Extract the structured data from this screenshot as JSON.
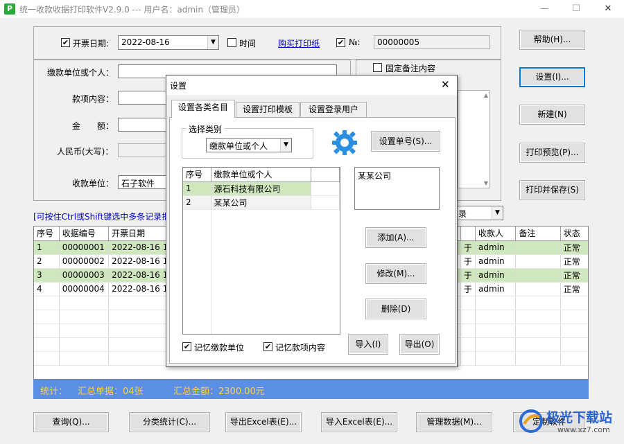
{
  "window": {
    "title": "统一收款收据打印软件V2.9.0 --- 用户名：admin（管理员）",
    "app_icon": "P",
    "minimize": "—",
    "maximize": "☐",
    "close": "✕"
  },
  "form": {
    "date_check_label": "开票日期:",
    "date_value": "2022-08-16",
    "time_label": "时间",
    "buy_paper_link": "购买打印纸",
    "no_label": "№:",
    "no_value": "00000005",
    "payer_label": "缴款单位或个人：",
    "item_label": "款项内容：",
    "amount_label": "金　　额：",
    "rmb_label": "人民币(大写)：",
    "receiver_label": "收款单位：",
    "receiver_value": "石子软件",
    "fixed_note_label": "固定备注内容"
  },
  "side_buttons": {
    "help": "帮助(H)...",
    "settings": "设置(I)...",
    "new": "新建(N)",
    "preview": "打印预览(P)...",
    "print_save": "打印并保存(S)"
  },
  "hint": "[可按住Ctrl或Shift键选中多条记录批",
  "filter_select_tail": "录",
  "records": {
    "headers": [
      "序号",
      "收据编号",
      "开票日期",
      "",
      "收款人",
      "备注",
      "状态"
    ],
    "rows": [
      {
        "no": "1",
        "receipt": "00000001",
        "date": "2022-08-16 1",
        "mid": "于",
        "payee": "admin",
        "note": "",
        "status": "正常",
        "green": true
      },
      {
        "no": "2",
        "receipt": "00000002",
        "date": "2022-08-16 1",
        "mid": "于",
        "payee": "admin",
        "note": "",
        "status": "正常",
        "green": false
      },
      {
        "no": "3",
        "receipt": "00000003",
        "date": "2022-08-16 1",
        "mid": "于",
        "payee": "admin",
        "note": "",
        "status": "正常",
        "green": true
      },
      {
        "no": "4",
        "receipt": "00000004",
        "date": "2022-08-16 1",
        "mid": "于",
        "payee": "admin",
        "note": "",
        "status": "正常",
        "green": false
      }
    ]
  },
  "status": {
    "stat_label": "统计：",
    "count_text": "汇总单据：04张",
    "sum_text": "汇总金额：2300.00元"
  },
  "bottom_buttons": {
    "query": "查询(Q)...",
    "category_stats": "分类统计(C)...",
    "export_excel": "导出Excel表(E)...",
    "import_excel": "导入Excel表(E)...",
    "manage_data": "管理数据(M)...",
    "customize": "定制软件"
  },
  "dialog": {
    "title": "设置",
    "close": "✕",
    "tabs": [
      "设置各类名目",
      "设置打印模板",
      "设置登录用户"
    ],
    "category_group": "选择类别",
    "category_value": "缴款单位或个人",
    "set_number_button": "设置单号(S)...",
    "list_headers": [
      "序号",
      "缴款单位或个人"
    ],
    "list_rows": [
      {
        "no": "1",
        "name": "源石科技有限公司"
      },
      {
        "no": "2",
        "name": "某某公司"
      }
    ],
    "edit_value": "某某公司",
    "add_button": "添加(A)...",
    "modify_button": "修改(M)...",
    "delete_button": "删除(D)",
    "remember_payer": "记忆缴款单位",
    "remember_item": "记忆款项内容",
    "import_button": "导入(I)",
    "export_button": "导出(O)"
  },
  "watermark": {
    "brand": "极光下载站",
    "url": "www.xz7.com"
  },
  "colors": {
    "status_bar": "#5b8fe6",
    "status_text": "#ffd23f",
    "row_highlight": "#cfe7bd",
    "gear_icon": "#2a8fe0"
  }
}
